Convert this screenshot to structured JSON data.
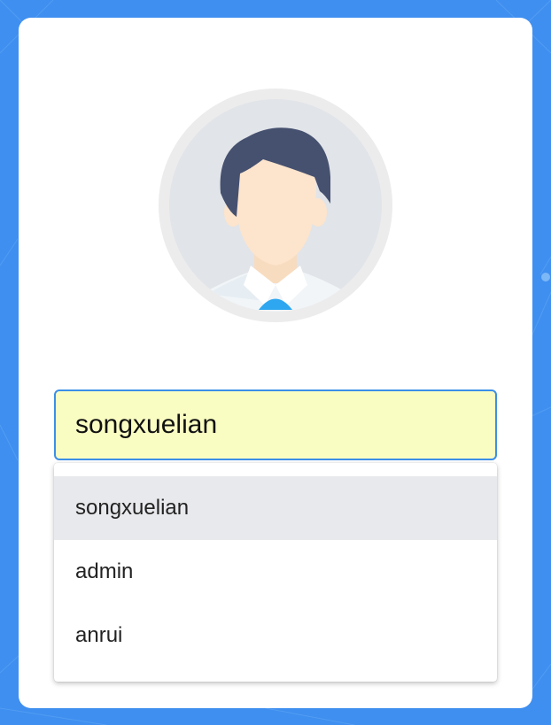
{
  "theme": {
    "background": "#3f8ff0",
    "card": "#ffffff",
    "input_background": "#fafdc2",
    "input_border": "#3b8fe8",
    "highlight": "#e8e9ec"
  },
  "login": {
    "avatar_icon": "user-avatar-icon",
    "username_value": "songxuelian",
    "autocomplete": {
      "items": [
        {
          "label": "songxuelian",
          "selected": true
        },
        {
          "label": "admin",
          "selected": false
        },
        {
          "label": "anrui",
          "selected": false
        }
      ]
    }
  }
}
